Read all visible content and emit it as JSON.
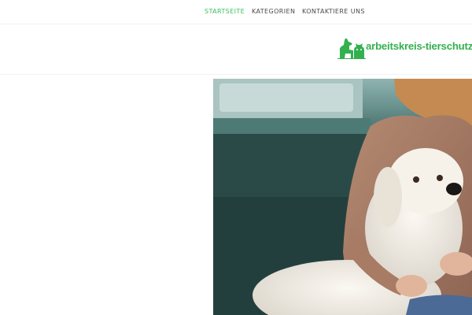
{
  "nav": {
    "items": [
      {
        "label": "STARTSEITE",
        "active": true
      },
      {
        "label": "KATEGORIEN",
        "active": false
      },
      {
        "label": "KONTAKTIERE UNS",
        "active": false
      }
    ],
    "active_color": "#3bbf5d"
  },
  "header": {
    "logo_text": "arbeitskreis-tierschutz.de",
    "logo_icon": "dog-cat-icon",
    "brand_color": "#33b04f"
  },
  "hero": {
    "image_subject": "white-dog-with-woman-photo"
  }
}
